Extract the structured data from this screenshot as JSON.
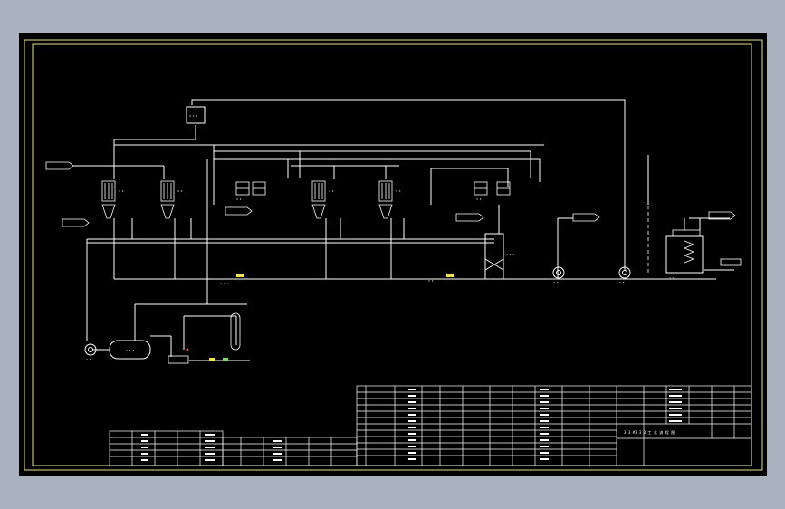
{
  "colors": {
    "background": "#a9b0be",
    "sheet": "#000000",
    "outer_frame": "#e9e58a",
    "inner_frame": "#e9e58a",
    "lines": "#ffffff",
    "accent_red": "#ff3b3b",
    "accent_yellow": "#f2e24a",
    "accent_green": "#7bd86b"
  },
  "labels": {
    "top_box": "3 3 3",
    "e3": "3 3",
    "e4": "3 3",
    "e5": "3 3",
    "e6": "3 3",
    "e7": "3 3",
    "e8": "3 3",
    "e9": "3 3",
    "e10": "3 3",
    "e11": "3 3",
    "e12": "3 3",
    "col_a": "3 3",
    "col_b": "3 3",
    "col_c": "3 3",
    "col_d": "3 3",
    "tank": "3 3 4",
    "pump1": "3 3",
    "pump2": "3 3",
    "pump3": "3 4",
    "drum": "3 4 3",
    "valve_a": "3 3 7",
    "valve_b": "3 3",
    "reactor": "3 3"
  },
  "title_block": {
    "drawing_title": "3 3 #3 3 3 工 艺 流 程 图"
  }
}
